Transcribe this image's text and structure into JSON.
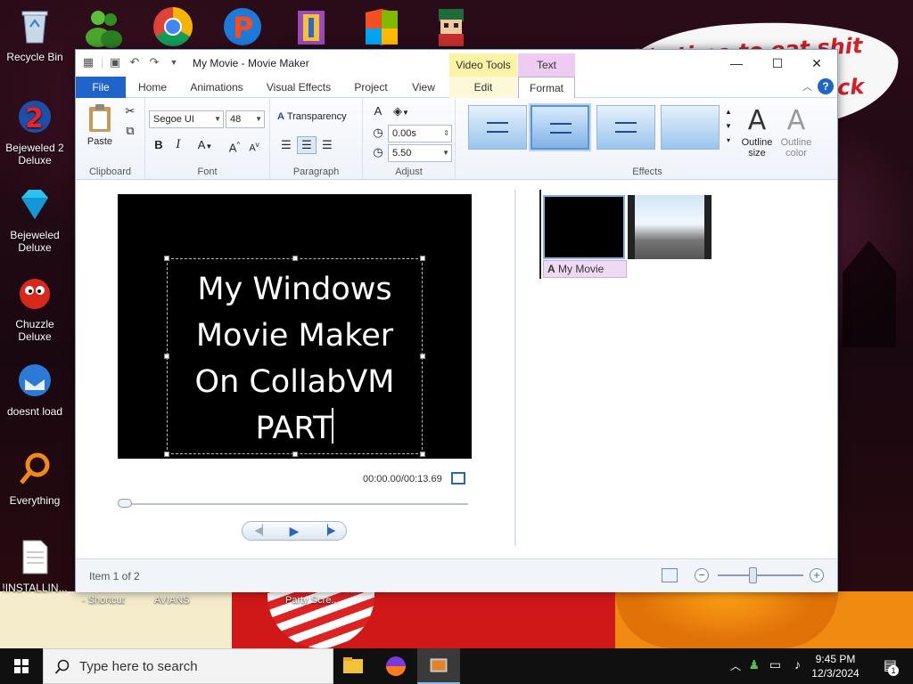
{
  "desktop": {
    "sign_lines": [
      "it's time to eat shit",
      "ck"
    ],
    "icons": [
      {
        "label": "Recycle Bin"
      },
      {
        "label": "Bejeweled 2 Deluxe"
      },
      {
        "label": "Bejeweled Deluxe"
      },
      {
        "label": "Chuzzle Deluxe"
      },
      {
        "label": "doesnt load"
      },
      {
        "label": "Everything"
      },
      {
        "label": "!INSTALLIN..."
      }
    ],
    "partial_labels": [
      "- Shortcut",
      "AVIANS",
      "Party Scre..."
    ]
  },
  "window": {
    "title": "My Movie - Movie Maker",
    "context_groups": {
      "video_tools": "Video Tools",
      "text_tools": "Text Tools"
    },
    "tabs": {
      "file": "File",
      "home": "Home",
      "animations": "Animations",
      "visual_effects": "Visual Effects",
      "project": "Project",
      "view": "View",
      "edit": "Edit",
      "format": "Format"
    },
    "ribbon": {
      "clipboard": {
        "paste": "Paste",
        "label": "Clipboard"
      },
      "font": {
        "family": "Segoe UI",
        "size": "48",
        "label": "Font"
      },
      "paragraph": {
        "transparency": "Transparency",
        "label": "Paragraph"
      },
      "adjust": {
        "start_time": "0.00s",
        "duration": "5.50",
        "label": "Adjust"
      },
      "effects": {
        "label": "Effects"
      },
      "outline": {
        "size": "Outline size",
        "color": "Outline color"
      }
    },
    "preview": {
      "caption_lines": [
        "My Windows",
        "Movie Maker",
        "On CollabVM",
        "PART"
      ],
      "time": "00:00.00/00:13.69"
    },
    "storyboard": {
      "clip_caption": "My Movie"
    },
    "status": {
      "item": "Item 1 of 2"
    }
  },
  "taskbar": {
    "search_placeholder": "Type here to search",
    "time": "9:45 PM",
    "date": "12/3/2024",
    "notification_count": "1"
  }
}
